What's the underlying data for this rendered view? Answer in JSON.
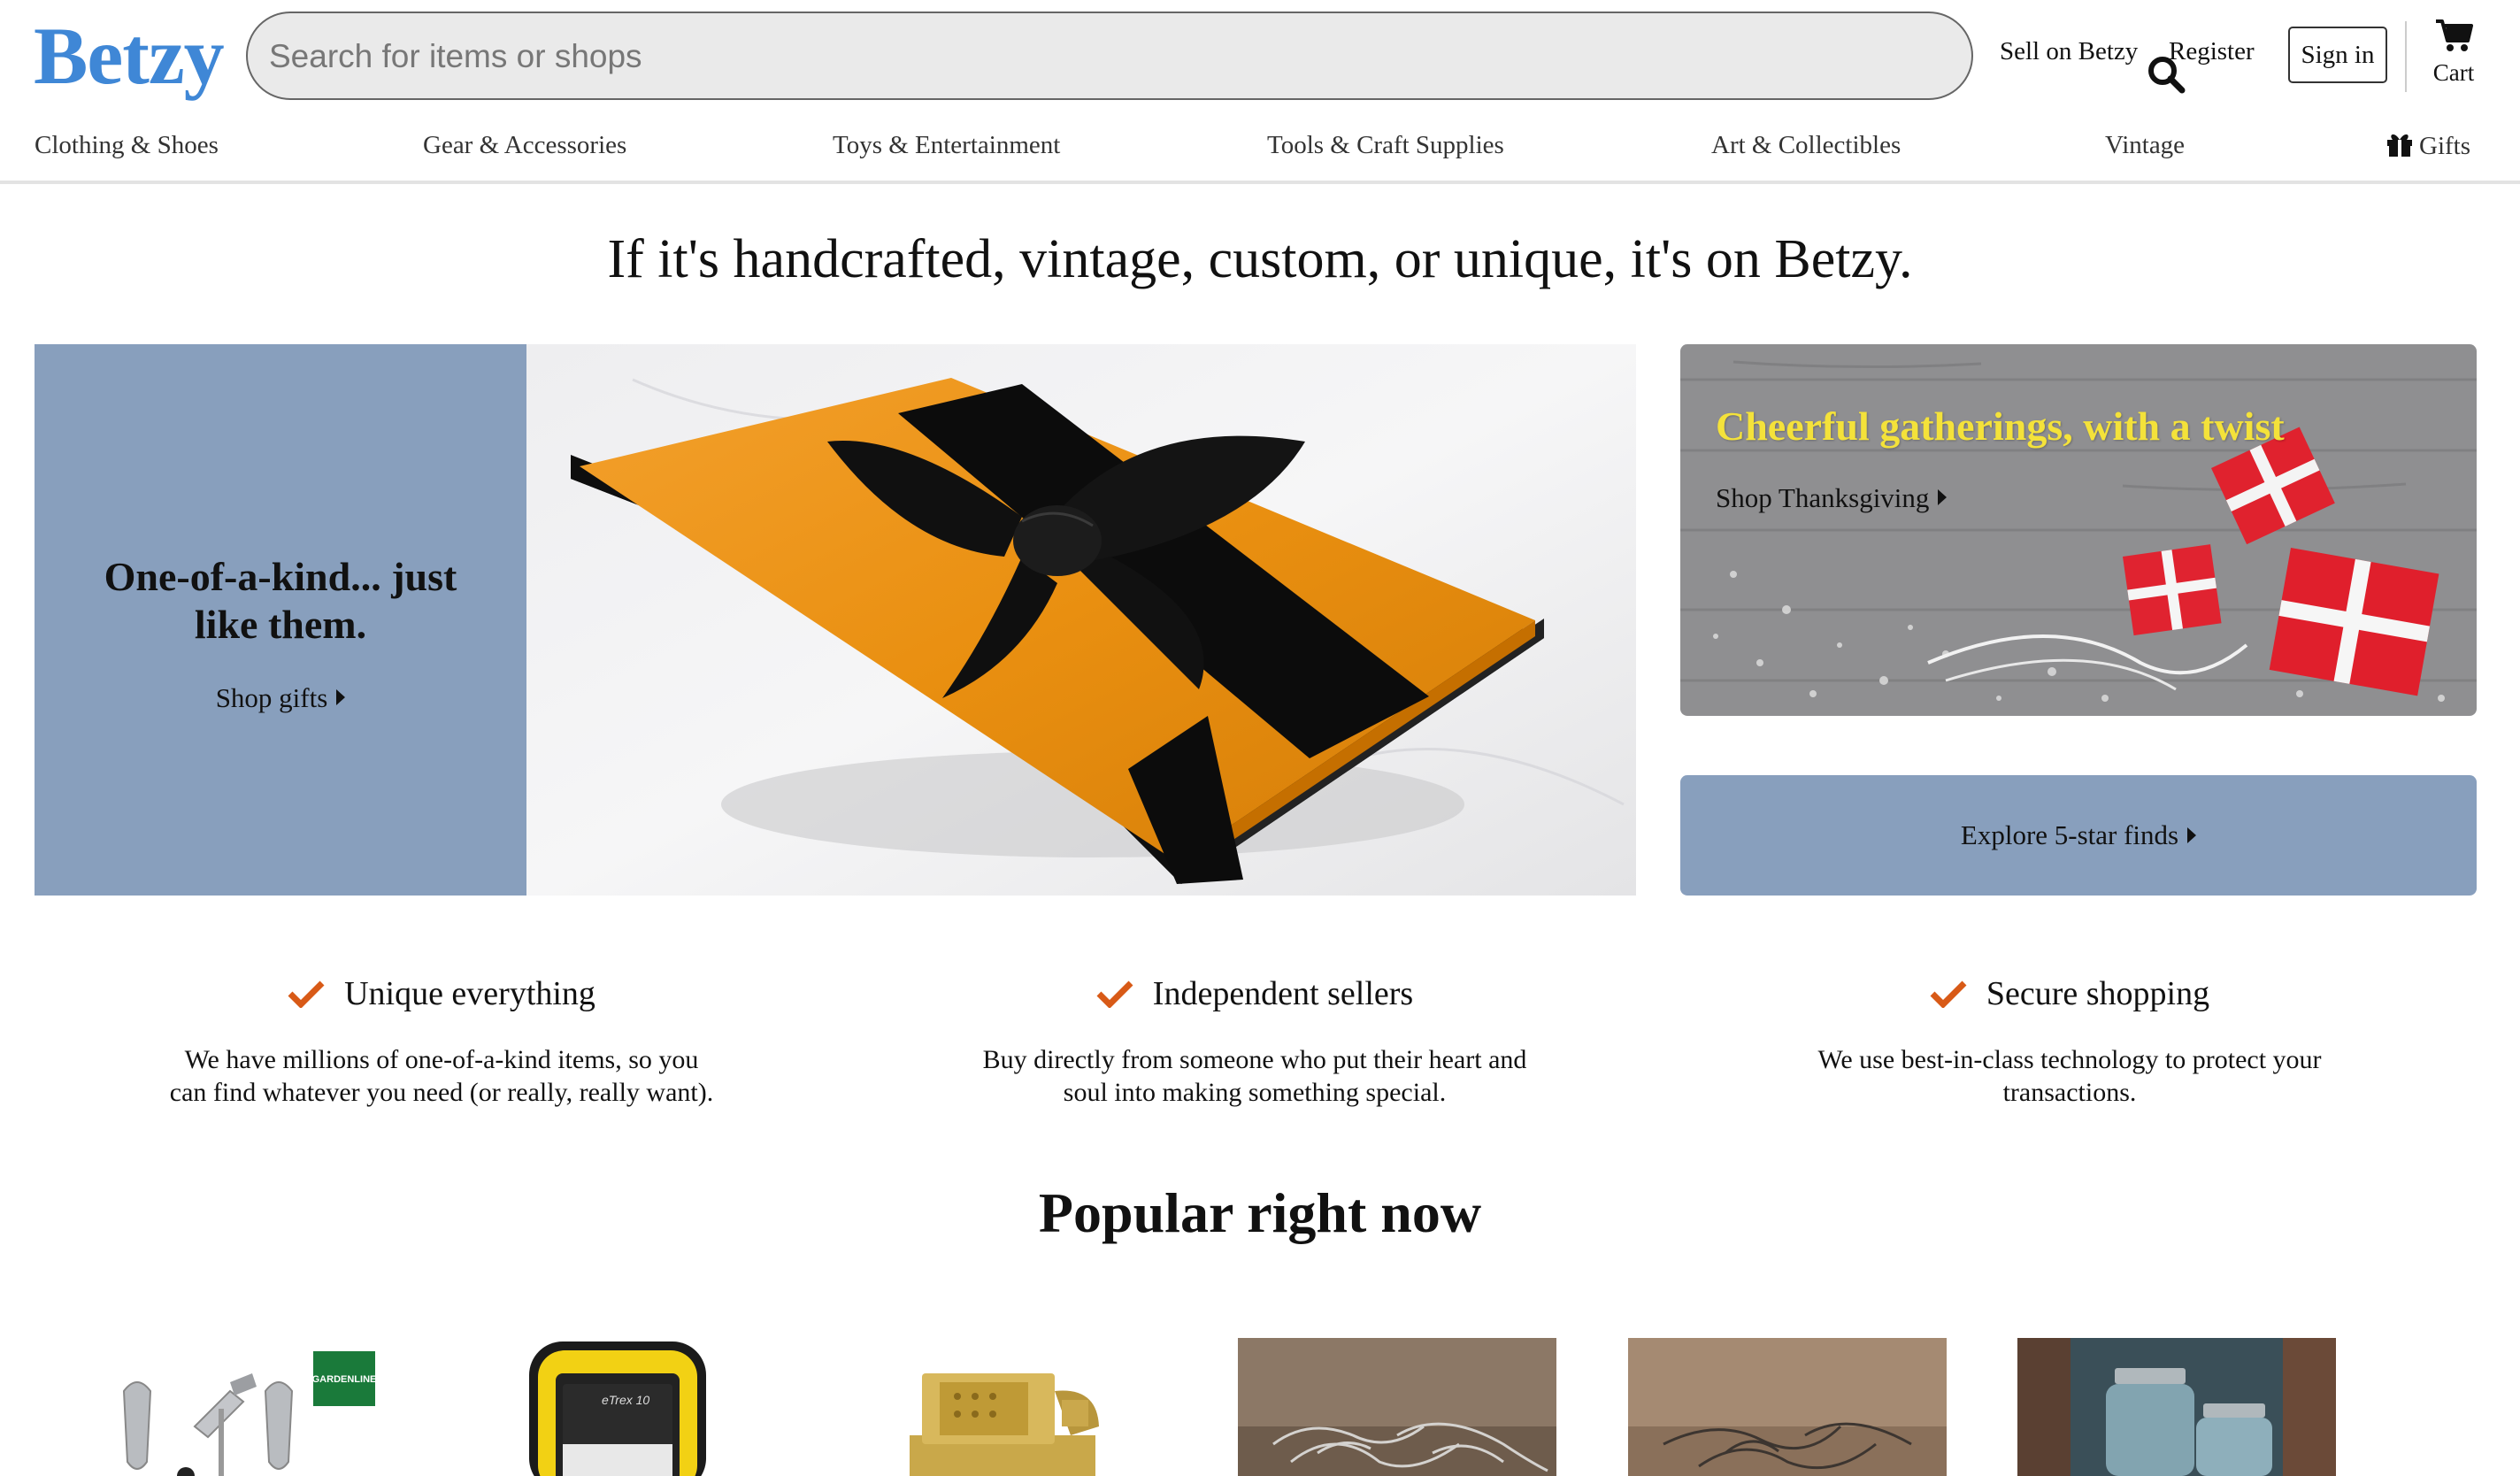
{
  "header": {
    "logo": "Betzy",
    "search_placeholder": "Search for items or shops",
    "sell_label": "Sell on Betzy",
    "register_label": "Register",
    "signin_label": "Sign in",
    "cart_label": "Cart"
  },
  "categories": [
    "Clothing & Shoes",
    "Gear & Accessories",
    "Toys & Entertainment",
    "Tools & Craft Supplies",
    "Art & Collectibles",
    "Vintage",
    "Gifts"
  ],
  "hero": {
    "tagline": "If it's handcrafted, vintage, custom, or unique, it's on Betzy.",
    "promo_title": "One-of-a-kind... just like them.",
    "promo_link": "Shop gifts",
    "side_title": "Cheerful gatherings, with a twist",
    "side_link": "Shop Thanksgiving",
    "explore_link": "Explore 5-star finds"
  },
  "features": [
    {
      "title": "Unique everything",
      "body": "We have millions of one-of-a-kind items, so you can find whatever you need (or really, really want)."
    },
    {
      "title": "Independent sellers",
      "body": "Buy directly from someone who put their heart and soul into making something special."
    },
    {
      "title": "Secure shopping",
      "body": "We use best-in-class technology to protect your transactions."
    }
  ],
  "popular": {
    "title": "Popular right now",
    "products": [
      "garden-tools",
      "gps-device",
      "brass-lighter",
      "wire-sculpture",
      "wire-sculpture-2",
      "mason-jars"
    ]
  },
  "colors": {
    "brand": "#3f87d6",
    "accent_panel": "#889fbd",
    "check": "#d85a17",
    "promo_text": "#f4e23a"
  }
}
